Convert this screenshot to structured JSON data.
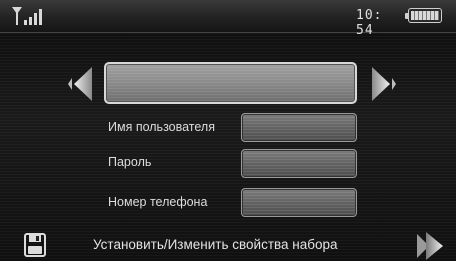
{
  "status_bar": {
    "time": "10: 54",
    "signal_icon": "signal-icon",
    "battery_icon": "battery-icon"
  },
  "selector": {
    "value": "",
    "prev_icon": "arrow-left-icon",
    "next_icon": "arrow-right-icon"
  },
  "form": {
    "username_label": "Имя пользователя",
    "username_value": "",
    "password_label": "Пароль",
    "password_value": "",
    "phone_label": "Номер телефона",
    "phone_value": ""
  },
  "bottom_bar": {
    "save_icon": "floppy-disk-icon",
    "text": "Установить/Изменить свойства набора",
    "next_icon": "double-arrow-right-icon"
  },
  "colors": {
    "background": "#151515",
    "field": "#7a7a7a",
    "text": "#e0e0e0"
  }
}
